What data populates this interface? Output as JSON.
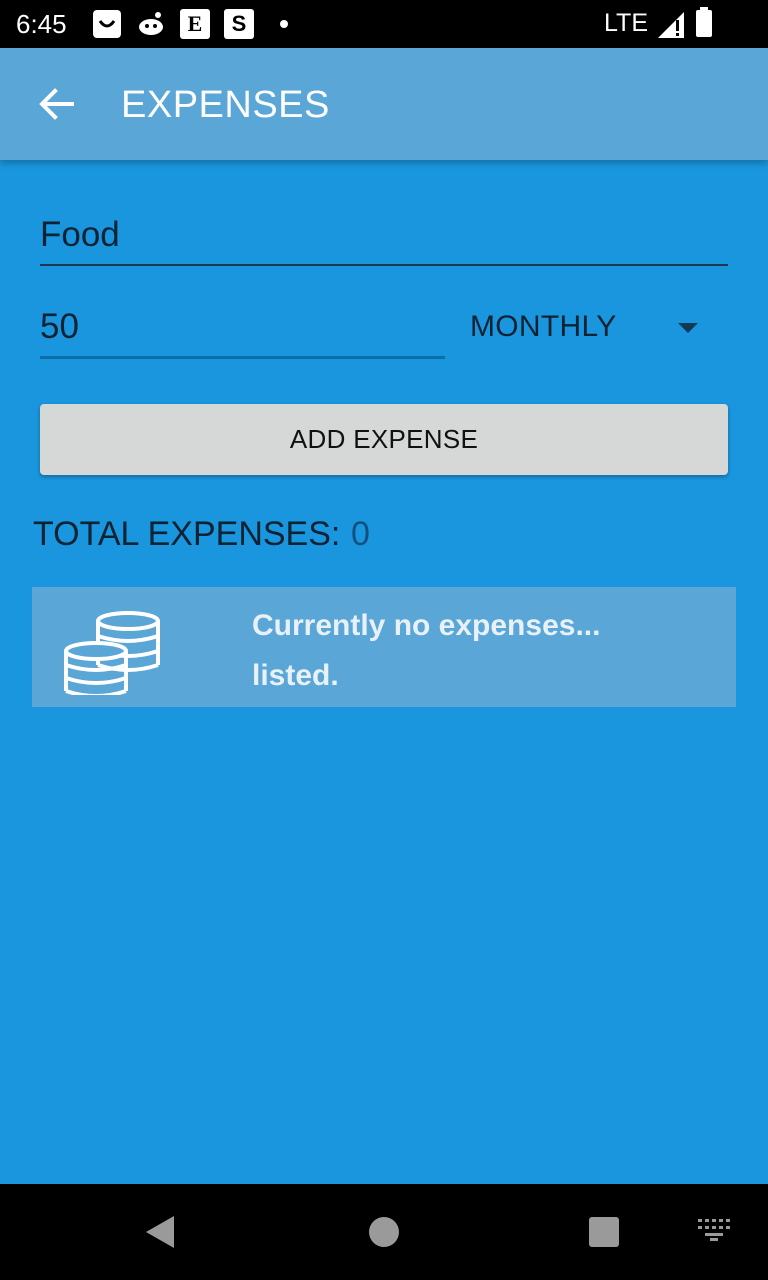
{
  "status_bar": {
    "time": "6:45",
    "icons": [
      "shopping-bag-icon",
      "reddit-icon",
      "etsy-icon",
      "s-app-icon",
      "notification-dot-icon"
    ],
    "etsy_letter": "E",
    "s_letter": "S",
    "network": "LTE"
  },
  "app_bar": {
    "title": "EXPENSES"
  },
  "form": {
    "name_value": "Food",
    "amount_value": "50",
    "frequency": "MONTHLY",
    "add_button_label": "ADD EXPENSE"
  },
  "summary": {
    "total_label": "TOTAL EXPENSES:",
    "total_value": "0"
  },
  "empty_state": {
    "message": "Currently no expenses... listed."
  },
  "colors": {
    "background": "#1a96de",
    "app_bar": "#5aa6d7",
    "button": "#d6d7d7"
  }
}
